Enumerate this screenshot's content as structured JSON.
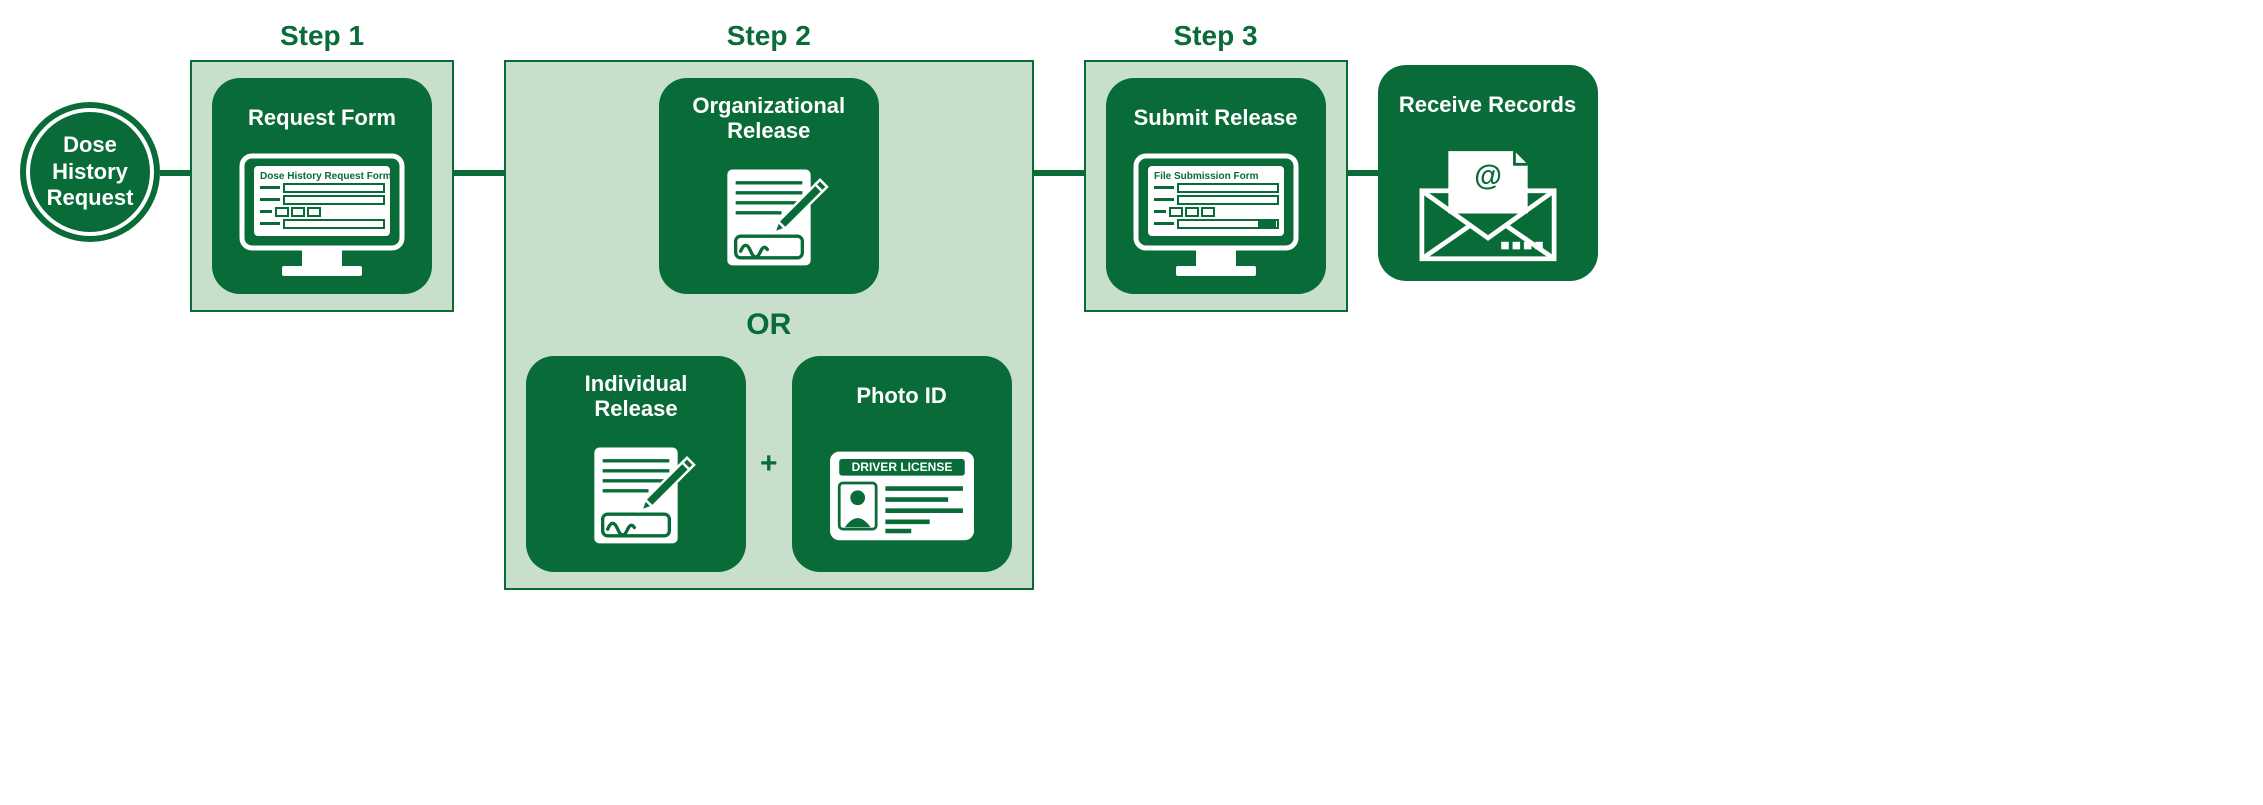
{
  "start": {
    "line1": "Dose",
    "line2": "History",
    "line3": "Request"
  },
  "step1": {
    "label": "Step 1",
    "card": {
      "title": "Request Form",
      "form_title": "Dose History Request Form"
    }
  },
  "step2": {
    "label": "Step 2",
    "org": {
      "title": "Organizational Release"
    },
    "or": "OR",
    "ind": {
      "title": "Individual Release"
    },
    "plus": "+",
    "photo": {
      "title": "Photo ID",
      "license_label": "DRIVER LICENSE"
    }
  },
  "step3": {
    "label": "Step 3",
    "card": {
      "title": "Submit Release",
      "form_title": "File Submission Form"
    }
  },
  "final": {
    "title": "Receive Records"
  }
}
